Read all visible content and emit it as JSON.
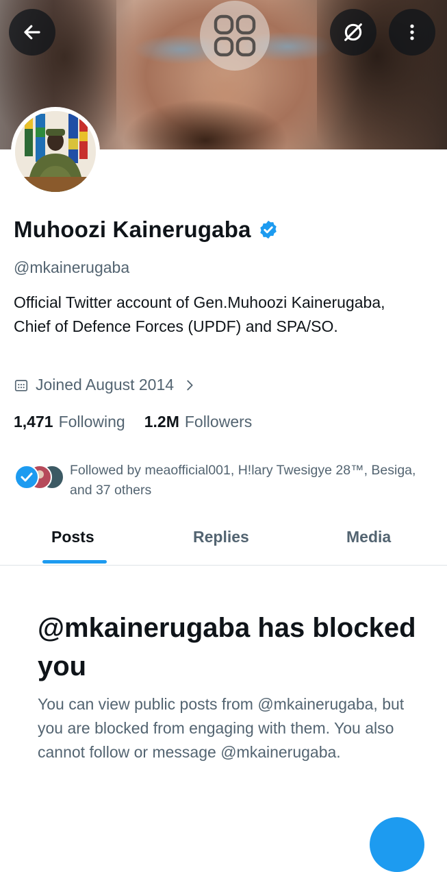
{
  "header": {
    "back_icon": "arrow-left-icon",
    "grid_icon": "four-squares-icon",
    "mute_icon": "slashed-circle-icon",
    "more_icon": "vertical-dots-icon"
  },
  "profile": {
    "name": "Muhoozi Kainerugaba",
    "verified": true,
    "handle": "@mkainerugaba",
    "bio": "Official Twitter account of Gen.Muhoozi Kainerugaba, Chief of Defence Forces (UPDF) and SPA/SO.",
    "joined": "Joined August 2014",
    "following_count": "1,471",
    "following_label": "Following",
    "followers_count": "1.2M",
    "followers_label": "Followers",
    "followed_by": "Followed by meaofficial001, H!lary Twesigye 28™, Besiga, and 37 others"
  },
  "tabs": [
    {
      "label": "Posts"
    },
    {
      "label": "Replies"
    },
    {
      "label": "Media"
    }
  ],
  "blocked": {
    "title": "@mkainerugaba has blocked you",
    "message": "You can view public posts from @mkainerugaba, but you are blocked from engaging with them. You also cannot follow or message @mkainerugaba."
  },
  "colors": {
    "accent": "#1d9bf0",
    "text_primary": "#0f1419",
    "text_secondary": "#536471"
  }
}
